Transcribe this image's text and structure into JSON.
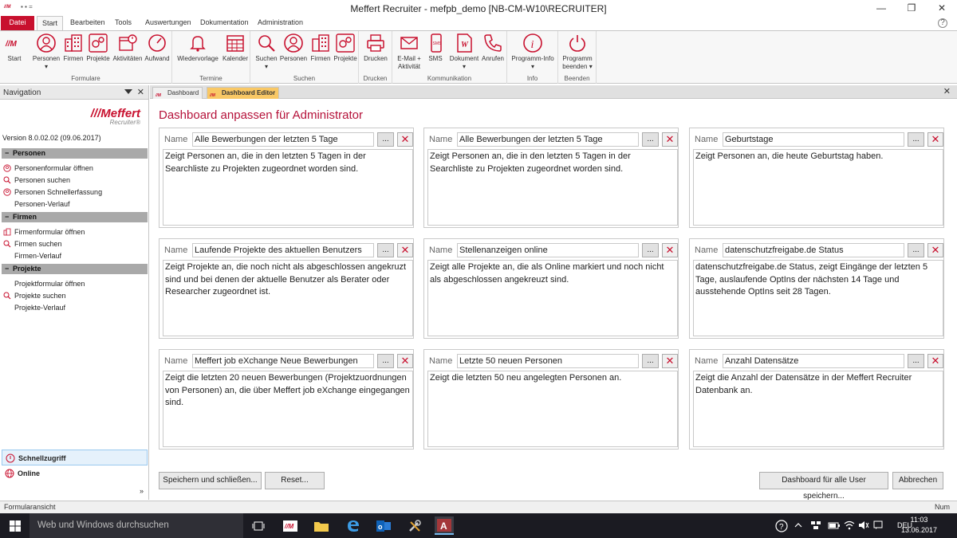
{
  "window": {
    "title": "Meffert Recruiter - mefpb_demo [NB-CM-W10\\RECRUITER]",
    "app_icon": "//M",
    "quick_access": "▪ ▪ =",
    "minimize": "—",
    "maximize": "❐",
    "close": "✕"
  },
  "ribbon_tabs": [
    "Datei",
    "Start",
    "Bearbeiten",
    "Tools",
    "Auswertungen",
    "Dokumentation",
    "Administration"
  ],
  "ribbon": {
    "groups": {
      "formulare": "Formulare",
      "termine": "Termine",
      "suchen": "Suchen",
      "drucken": "Drucken",
      "kommunikation": "Kommunikation",
      "info": "Info",
      "beenden": "Beenden"
    },
    "buttons": {
      "start": "Start",
      "personen": "Personen",
      "firmen": "Firmen",
      "projekte": "Projekte",
      "aktivitaeten": "Aktivitäten",
      "aufwand": "Aufwand",
      "wiedervorlage": "Wiedervorlage",
      "kalender": "Kalender",
      "suchen": "Suchen",
      "s_personen": "Personen",
      "s_firmen": "Firmen",
      "s_projekte": "Projekte",
      "drucken": "Drucken",
      "email": "E-Mail +",
      "email2": "Aktivität",
      "sms": "SMS",
      "dokument": "Dokument",
      "anrufen": "Anrufen",
      "programminfo": "Programm-Info",
      "programm": "Programm",
      "beenden": "beenden"
    },
    "dropdown_arrow": "▾",
    "sms_icon_text": "SMS",
    "dokument_icon_text": "W",
    "info_icon_text": "i"
  },
  "navigation": {
    "title": "Navigation",
    "close": "✕",
    "logo_main": "///Meffert",
    "logo_sub": "Recruiter®",
    "version": "Version 8.0.02.02  (09.06.2017)",
    "sections": [
      {
        "title": "Personen",
        "toggle": "−",
        "items": [
          "Personenformular öffnen",
          "Personen suchen",
          "Personen Schnellerfassung",
          "Personen-Verlauf"
        ]
      },
      {
        "title": "Firmen",
        "toggle": "−",
        "items": [
          "Firmenformular öffnen",
          "Firmen suchen",
          "Firmen-Verlauf"
        ]
      },
      {
        "title": "Projekte",
        "toggle": "−",
        "items": [
          "Projektformular öffnen",
          "Projekte suchen",
          "Projekte-Verlauf"
        ]
      }
    ],
    "bottom": [
      "Schnellzugriff",
      "Online"
    ],
    "more": "»"
  },
  "doc_tabs": [
    {
      "label": "Dashboard",
      "icon": "//M"
    },
    {
      "label": "Dashboard Editor",
      "icon": "//M"
    }
  ],
  "doc_close": "✕",
  "page_title": "Dashboard anpassen für Administrator",
  "name_label": "Name",
  "dots_label": "...",
  "delete_label": "✕",
  "cards": [
    {
      "name": "Alle Bewerbungen der letzten 5 Tage",
      "desc": "Zeigt Personen an, die in den letzten 5 Tagen in der Searchliste zu Projekten zugeordnet worden sind."
    },
    {
      "name": "Alle Bewerbungen der letzten 5 Tage",
      "desc": "Zeigt Personen an, die in den letzten 5 Tagen in der Searchliste zu Projekten zugeordnet worden sind."
    },
    {
      "name": "Geburtstage",
      "desc": "Zeigt Personen an, die heute Geburtstag haben."
    },
    {
      "name": "Laufende Projekte des aktuellen Benutzers",
      "desc": "Zeigt Projekte an, die noch nicht als abgeschlossen angekruzt sind und bei denen der aktuelle Benutzer als Berater oder Researcher zugeordnet ist."
    },
    {
      "name": "Stellenanzeigen online",
      "desc": "Zeigt alle Projekte an, die als Online markiert und noch nicht als abgeschlossen angekreuzt sind."
    },
    {
      "name": "datenschutzfreigabe.de Status",
      "desc": "datenschutzfreigabe.de Status, zeigt Eingänge der letzten 5 Tage, auslaufende OptIns der nächsten 14 Tage und ausstehende OptIns seit 28 Tagen."
    },
    {
      "name": "Meffert job eXchange Neue Bewerbungen",
      "desc": "Zeigt die letzten 20 neuen Bewerbungen (Projektzuordnungen von Personen) an, die über Meffert job eXchange eingegangen sind."
    },
    {
      "name": "Letzte 50 neuen Personen",
      "desc": "Zeigt die letzten 50 neu angelegten Personen an."
    },
    {
      "name": "Anzahl Datensätze",
      "desc": "Zeigt die Anzahl der Datensätze in der Meffert Recruiter Datenbank an."
    }
  ],
  "buttons": {
    "save_close": "Speichern und schließen...",
    "reset": "Reset...",
    "save_all": "Dashboard für alle User speichern...",
    "cancel": "Abbrechen"
  },
  "statusbar": {
    "left": "Formularansicht",
    "right": "Num"
  },
  "taskbar": {
    "search_placeholder": "Web und Windows durchsuchen",
    "language": "DEU",
    "time": "11:03",
    "date": "13.06.2017",
    "recruiter_icon": "//M",
    "access_icon": "A"
  },
  "colors": {
    "accent_red": "#c8102e",
    "title_red": "#b5123a",
    "active_tab": "#f9c865",
    "taskbar": "#1b1b22"
  }
}
